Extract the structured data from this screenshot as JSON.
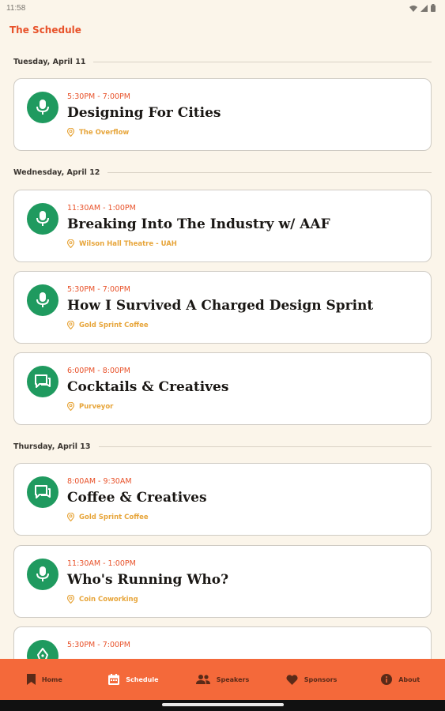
{
  "status": {
    "time": "11:58"
  },
  "header": {
    "title": "The Schedule"
  },
  "colors": {
    "accent": "#e8522a",
    "icon_bg": "#1f9a5f",
    "location": "#e7a53a",
    "nav_bg": "#f4693a"
  },
  "days": [
    {
      "label": "Tuesday, April 11",
      "events": [
        {
          "icon": "microphone-icon",
          "time": "5:30PM - 7:00PM",
          "title": "Designing For Cities",
          "location": "The Overflow"
        }
      ]
    },
    {
      "label": "Wednesday, April 12",
      "events": [
        {
          "icon": "microphone-icon",
          "time": "11:30AM - 1:00PM",
          "title": "Breaking Into The Industry w/ AAF",
          "location": "Wilson Hall Theatre - UAH"
        },
        {
          "icon": "microphone-icon",
          "time": "5:30PM - 7:00PM",
          "title": "How I Survived A Charged Design Sprint",
          "location": "Gold Sprint Coffee"
        },
        {
          "icon": "chat-icon",
          "time": "6:00PM - 8:00PM",
          "title": "Cocktails & Creatives",
          "location": "Purveyor"
        }
      ]
    },
    {
      "label": "Thursday, April 13",
      "events": [
        {
          "icon": "chat-icon",
          "time": "8:00AM - 9:30AM",
          "title": "Coffee & Creatives",
          "location": "Gold Sprint Coffee"
        },
        {
          "icon": "microphone-icon",
          "time": "11:30AM - 1:00PM",
          "title": "Who's Running Who?",
          "location": "Coin Coworking"
        },
        {
          "icon": "pen-nib-icon",
          "time": "5:30PM - 7:00PM",
          "title": "",
          "location": ""
        }
      ]
    }
  ],
  "nav": [
    {
      "label": "Home",
      "icon": "bookmark-icon",
      "active": false
    },
    {
      "label": "Schedule",
      "icon": "calendar-icon",
      "active": true
    },
    {
      "label": "Speakers",
      "icon": "people-icon",
      "active": false
    },
    {
      "label": "Sponsors",
      "icon": "heart-icon",
      "active": false
    },
    {
      "label": "About",
      "icon": "info-icon",
      "active": false
    }
  ]
}
